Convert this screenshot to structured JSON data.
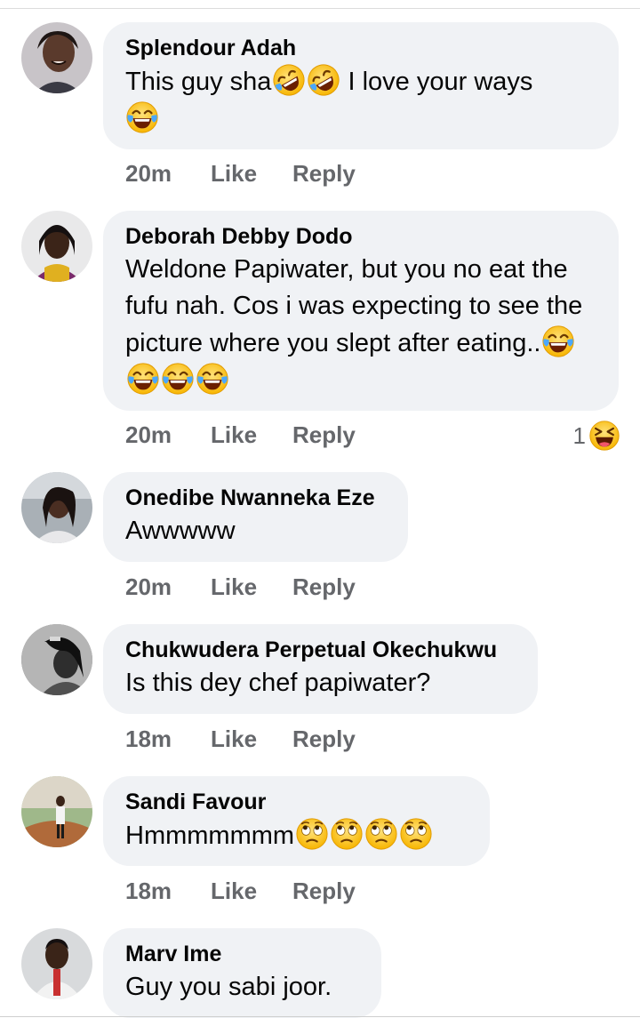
{
  "comments": [
    {
      "author": "Splendour Adah",
      "text": "This guy sha",
      "text_after": " I love your ways",
      "emoji": [
        "rolling-laughing",
        "rolling-laughing",
        "tears-of-joy"
      ],
      "time": "20m",
      "like": "Like",
      "reply": "Reply"
    },
    {
      "author": "Deborah Debby Dodo",
      "text": "Weldone Papiwater, but you no eat the fufu nah. Cos i was expecting to see the picture where you slept after eating..",
      "emoji": [
        "tears-of-joy",
        "tears-of-joy",
        "tears-of-joy",
        "tears-of-joy"
      ],
      "time": "20m",
      "like": "Like",
      "reply": "Reply",
      "reaction": {
        "count": "1",
        "icon": "haha-reaction"
      }
    },
    {
      "author": "Onedibe Nwanneka Eze",
      "text": "Awwwww",
      "time": "20m",
      "like": "Like",
      "reply": "Reply"
    },
    {
      "author": "Chukwudera Perpetual Okechukwu",
      "text": "Is this dey chef papiwater?",
      "time": "18m",
      "like": "Like",
      "reply": "Reply"
    },
    {
      "author": "Sandi Favour",
      "text": "Hmmmmmmm",
      "emoji": [
        "rolling-eyes",
        "rolling-eyes",
        "rolling-eyes",
        "rolling-eyes"
      ],
      "time": "18m",
      "like": "Like",
      "reply": "Reply"
    },
    {
      "author": "Marv Ime",
      "text": "Guy you sabi joor."
    }
  ],
  "colors": {
    "bubble": "#f0f2f5",
    "meta": "#65676b",
    "emoji_yellow": "#ffcc33"
  }
}
